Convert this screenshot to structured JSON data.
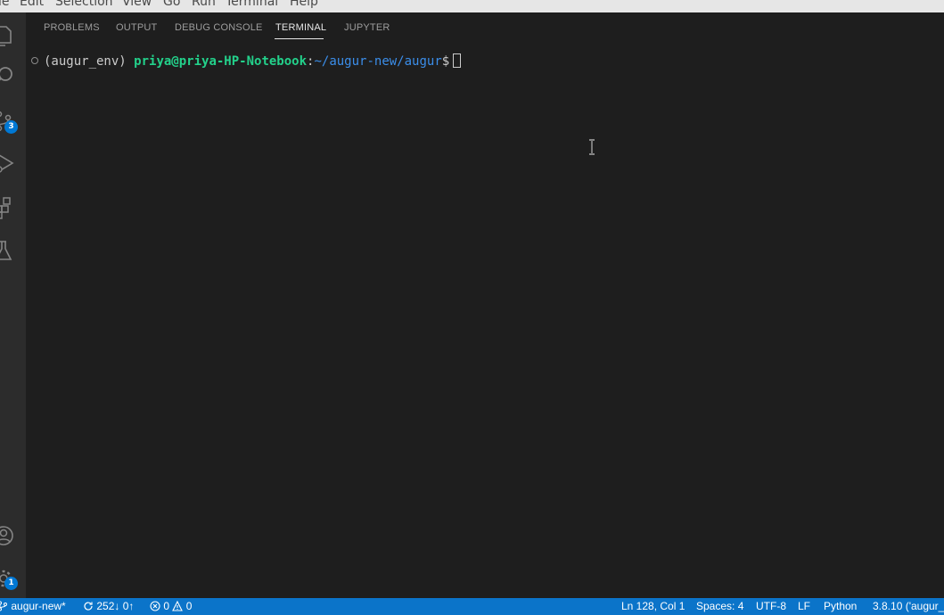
{
  "menu": {
    "items": [
      "le",
      "Edit",
      "Selection",
      "View",
      "Go",
      "Run",
      "Terminal",
      "Help"
    ]
  },
  "activity_bar": {
    "items": [
      {
        "name": "explorer-icon"
      },
      {
        "name": "search-icon"
      },
      {
        "name": "source-control-icon",
        "badge": "3"
      },
      {
        "name": "run-debug-icon"
      },
      {
        "name": "extensions-icon"
      },
      {
        "name": "testing-icon"
      }
    ],
    "bottom": [
      {
        "name": "account-icon"
      },
      {
        "name": "manage-gear-icon",
        "badge": "1"
      }
    ]
  },
  "panel": {
    "tabs": [
      "PROBLEMS",
      "OUTPUT",
      "DEBUG CONSOLE",
      "TERMINAL",
      "JUPYTER"
    ],
    "active_tab": "TERMINAL"
  },
  "terminal": {
    "env": "(augur_env) ",
    "user_host": "priya@priya-HP-Notebook",
    "colon": ":",
    "path": "~/augur-new/augur",
    "dollar": "$"
  },
  "statusbar": {
    "branch": "augur-new*",
    "sync": "252↓ 0↑",
    "errors": "0",
    "warnings": "0",
    "position": "Ln 128, Col 1",
    "spaces": "Spaces: 4",
    "encoding": "UTF-8",
    "eol": "LF",
    "language": "Python",
    "interpreter": "3.8.10 ('augur_"
  },
  "colors": {
    "statusbar_bg": "#0b74c9",
    "badge": "#0078d4",
    "terminal_user": "#23d18b",
    "terminal_path": "#3b8eea"
  }
}
